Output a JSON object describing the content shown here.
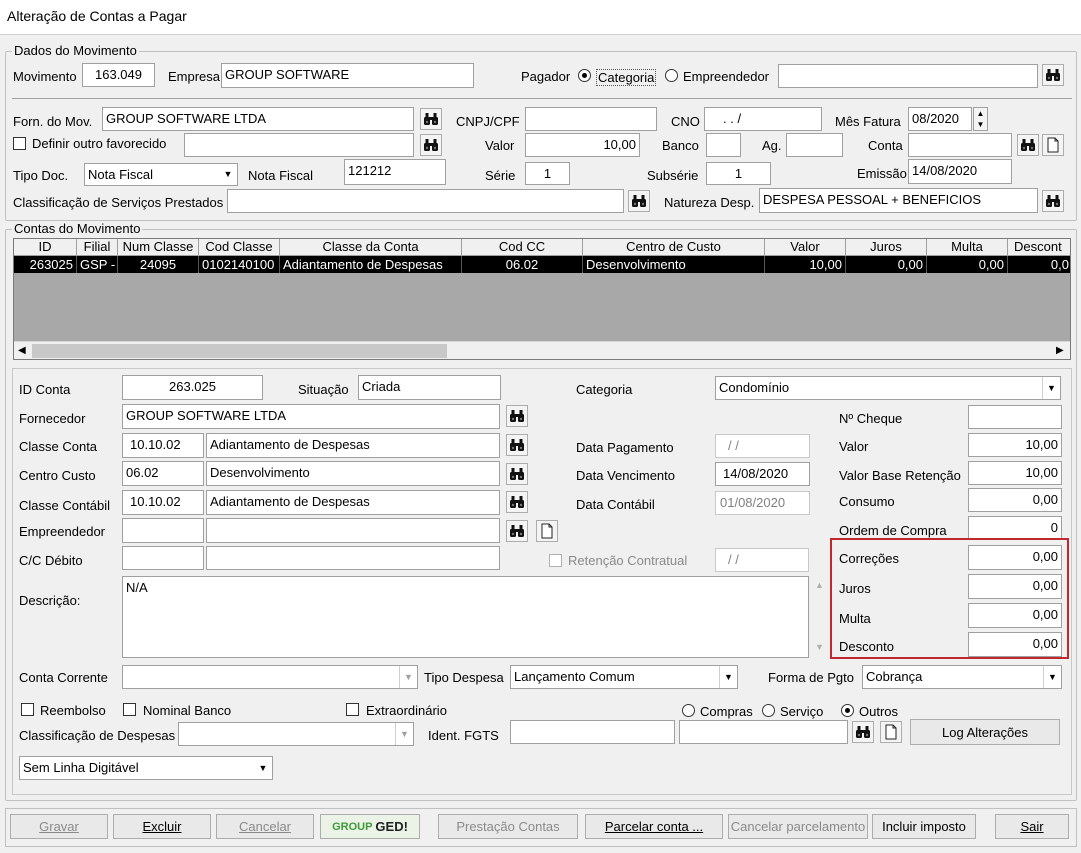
{
  "window": {
    "title": "Alteração de Contas a Pagar"
  },
  "dados": {
    "legend": "Dados do Movimento",
    "movimento_label": "Movimento",
    "movimento": "163.049",
    "empresa_label": "Empresa",
    "empresa": "GROUP SOFTWARE",
    "pagador_label": "Pagador",
    "opt_categoria": "Categoria",
    "opt_empreendedor": "Empreendedor",
    "pagador_value": "",
    "forn_label": "Forn. do Mov.",
    "forn": "GROUP SOFTWARE LTDA",
    "cnpj_label": "CNPJ/CPF",
    "cnpj": "",
    "cno_label": "CNO",
    "cno": ".   .     /",
    "mes_label": "Mês Fatura",
    "mes": "08/2020",
    "definir_label": "Definir outro favorecido",
    "definir_value": "",
    "valor_label": "Valor",
    "valor": "10,00",
    "banco_label": "Banco",
    "banco": "",
    "ag_label": "Ag.",
    "ag": "",
    "conta_label": "Conta",
    "conta": "",
    "tipo_label": "Tipo Doc.",
    "tipo": "Nota Fiscal",
    "nota_label": "Nota Fiscal",
    "nota": "121212",
    "serie_label": "Série",
    "serie": "1",
    "subserie_label": "Subsérie",
    "subserie": "1",
    "emissao_label": "Emissão",
    "emissao": "14/08/2020",
    "class_label": "Classificação de Serviços Prestados",
    "class_value": "",
    "natureza_label": "Natureza Desp.",
    "natureza": "DESPESA PESSOAL + BENEFICIOS"
  },
  "contas": {
    "legend": "Contas do Movimento",
    "columns": [
      "ID",
      "Filial",
      "Num Classe",
      "Cod Classe",
      "Classe da Conta",
      "Cod CC",
      "Centro de Custo",
      "Valor",
      "Juros",
      "Multa",
      "Descont"
    ],
    "row": [
      "263025",
      "GSP -",
      "24095",
      "0102140100",
      "Adiantamento de Despesas",
      "06.02",
      "Desenvolvimento",
      "10,00",
      "0,00",
      "0,00",
      "0,0"
    ]
  },
  "detail": {
    "id_label": "ID Conta",
    "id": "263.025",
    "situacao_label": "Situação",
    "situacao": "Criada",
    "categoria_label": "Categoria",
    "categoria": "Condomínio",
    "fornecedor_label": "Fornecedor",
    "fornecedor": "GROUP SOFTWARE LTDA",
    "cheque_label": "Nº Cheque",
    "cheque": "",
    "classe_label": "Classe Conta",
    "classe_cod": "10.10.02",
    "classe_desc": "Adiantamento de Despesas",
    "datapag_label": "Data Pagamento",
    "datapag": "/ /",
    "valor_label": "Valor",
    "valor": "10,00",
    "centro_label": "Centro Custo",
    "centro_cod": "06.02",
    "centro_desc": "Desenvolvimento",
    "datavenc_label": "Data Vencimento",
    "datavenc": "14/08/2020",
    "valorbase_label": "Valor Base Retenção",
    "valorbase": "10,00",
    "contabil_label": "Classe Contábil",
    "contabil_cod": "10.10.02",
    "contabil_desc": "Adiantamento de Despesas",
    "datacont_label": "Data Contábil",
    "datacont": "01/08/2020",
    "consumo_label": "Consumo",
    "consumo": "0,00",
    "empreendedor_label": "Empreendedor",
    "empreendedor_cod": "",
    "empreendedor_desc": "",
    "ordem_label": "Ordem de Compra",
    "ordem": "0",
    "ccdebito_label": "C/C Débito",
    "ccdebito_cod": "",
    "ccdebito_desc": "",
    "retencao_label": "Retenção Contratual",
    "retencao": "/ /",
    "correcoes_label": "Correções",
    "correcoes": "0,00",
    "descricao_label": "Descrição:",
    "descricao": "N/A",
    "juros_label": "Juros",
    "juros": "0,00",
    "multa_label": "Multa",
    "multa": "0,00",
    "desconto_label": "Desconto",
    "desconto": "0,00",
    "contacorrente_label": "Conta Corrente",
    "contacorrente": "",
    "tipodespesa_label": "Tipo Despesa",
    "tipodespesa": "Lançamento Comum",
    "formapgto_label": "Forma de Pgto",
    "formapgto": "Cobrança",
    "reembolso_label": "Reembolso",
    "nominal_label": "Nominal Banco",
    "extra_label": "Extraordinário",
    "opt_compras": "Compras",
    "opt_servico": "Serviço",
    "opt_outros": "Outros",
    "classdesp_label": "Classificação de Despesas",
    "classdesp": "",
    "fgts_label": "Ident. FGTS",
    "fgts": "",
    "fgts2": "",
    "log_label": "Log Alterações",
    "linha": "Sem Linha Digitável"
  },
  "footer": {
    "gravar": "Gravar",
    "excluir": "Excluir",
    "cancelar": "Cancelar",
    "ged_group": "GROUP",
    "ged_ged": "GED!",
    "prestacao": "Prestação Contas",
    "parcelar": "Parcelar conta ...",
    "cancelar_parc": "Cancelar parcelamento",
    "incluir": "Incluir imposto",
    "sair": "Sair"
  },
  "colors": {
    "highlight_border": "#c0282d",
    "grid_selection": "#000000"
  }
}
